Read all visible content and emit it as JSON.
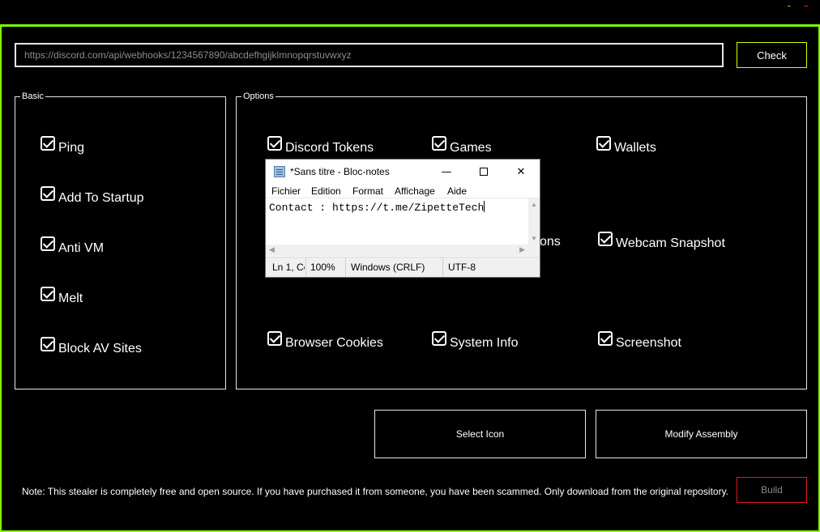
{
  "window": {
    "minimize_glyph": "-",
    "close_glyph": "–"
  },
  "webhook": {
    "value": "https://discord.com/api/webhooks/1234567890/abcdefhgijklmnopqrstuvwxyz",
    "check_label": "Check"
  },
  "basic": {
    "title": "Basic",
    "items": [
      "Ping",
      "Add To Startup",
      "Anti VM",
      "Melt",
      "Block AV Sites"
    ]
  },
  "options": {
    "title": "Options",
    "items": {
      "discord_tokens": "Discord Tokens",
      "games": "Games",
      "wallets": "Wallets",
      "partial_ons": "ons",
      "webcam_snapshot": "Webcam Snapshot",
      "browser_cookies": "Browser Cookies",
      "system_info": "System Info",
      "screenshot": "Screenshot"
    }
  },
  "buttons": {
    "select_icon": "Select Icon",
    "modify_assembly": "Modify Assembly",
    "build": "Build"
  },
  "note": "Note: This stealer is completely free and open source. If you have purchased it from someone, you have been scammed. Only download from the original repository.",
  "notepad": {
    "title": "*Sans titre - Bloc-notes",
    "menu": [
      "Fichier",
      "Edition",
      "Format",
      "Affichage",
      "Aide"
    ],
    "content": "Contact : https://t.me/ZipetteTech",
    "status": {
      "position": "Ln 1, Co",
      "zoom": "100%",
      "line_ending": "Windows (CRLF)",
      "encoding": "UTF-8"
    }
  },
  "colors": {
    "frame_border": "#7fff00",
    "check_border": "#d9ff00",
    "build_border": "#e01b1b"
  }
}
